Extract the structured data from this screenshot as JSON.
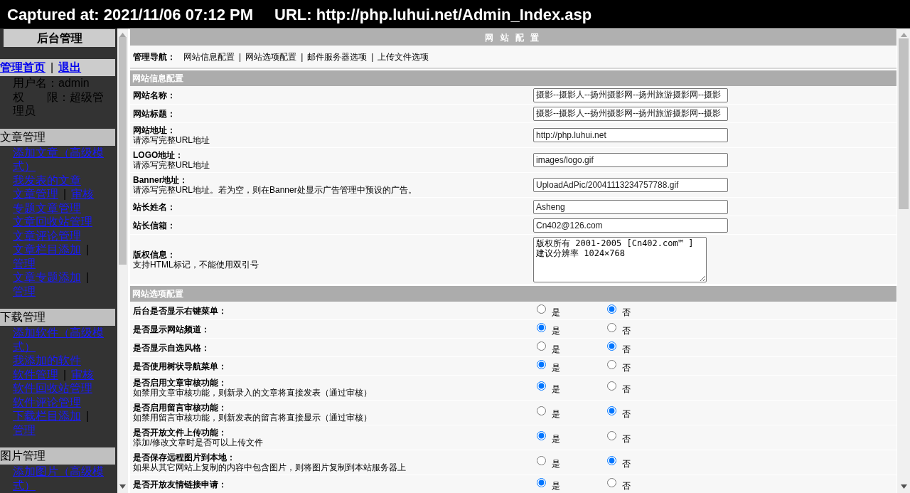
{
  "capture_bar": {
    "captured": "Captured at: 2021/11/06 07:12 PM",
    "url": "URL: http://php.luhui.net/Admin_Index.asp"
  },
  "sidebar": {
    "title": "后台管理",
    "nav": [
      {
        "kind": "link",
        "text": "管理首页"
      },
      {
        "kind": "sep",
        "text": "|"
      },
      {
        "kind": "link",
        "text": "退出"
      }
    ],
    "user_lines": [
      "用户名：admin",
      "权　　限：超级管理员"
    ],
    "sections": [
      {
        "title": "文章管理",
        "items": [
          [
            {
              "kind": "link",
              "text": "添加文章（高级模式）"
            }
          ],
          [
            {
              "kind": "link",
              "text": "我发表的文章"
            }
          ],
          [
            {
              "kind": "link",
              "text": "文章管理"
            },
            {
              "kind": "sep",
              "text": "|"
            },
            {
              "kind": "link",
              "text": "审核"
            }
          ],
          [
            {
              "kind": "link",
              "text": "专题文章管理"
            }
          ],
          [
            {
              "kind": "link",
              "text": "文章回收站管理"
            }
          ],
          [
            {
              "kind": "link",
              "text": "文章评论管理"
            }
          ],
          [
            {
              "kind": "link",
              "text": "文章栏目添加"
            },
            {
              "kind": "sep",
              "text": "|"
            },
            {
              "kind": "link",
              "text": "管理"
            }
          ],
          [
            {
              "kind": "link",
              "text": "文章专题添加"
            },
            {
              "kind": "sep",
              "text": "|"
            },
            {
              "kind": "link",
              "text": "管理"
            }
          ]
        ]
      },
      {
        "title": "下载管理",
        "items": [
          [
            {
              "kind": "link",
              "text": "添加软件（高级模式）"
            }
          ],
          [
            {
              "kind": "link",
              "text": "我添加的软件"
            }
          ],
          [
            {
              "kind": "link",
              "text": "软件管理"
            },
            {
              "kind": "sep",
              "text": "|"
            },
            {
              "kind": "link",
              "text": "审核"
            }
          ],
          [
            {
              "kind": "link",
              "text": "软件回收站管理"
            }
          ],
          [
            {
              "kind": "link",
              "text": "软件评论管理"
            }
          ],
          [
            {
              "kind": "link",
              "text": "下载栏目添加"
            },
            {
              "kind": "sep",
              "text": "|"
            },
            {
              "kind": "link",
              "text": "管理"
            }
          ]
        ]
      },
      {
        "title": "图片管理",
        "items": [
          [
            {
              "kind": "link",
              "text": "添加图片（高级模式）"
            }
          ]
        ]
      }
    ]
  },
  "main": {
    "title": "网 站 配 置",
    "nav_label": "管理导航：",
    "nav": [
      {
        "kind": "link",
        "text": "网站信息配置"
      },
      {
        "kind": "sep",
        "text": "|"
      },
      {
        "kind": "link",
        "text": "网站选项配置"
      },
      {
        "kind": "sep",
        "text": "|"
      },
      {
        "kind": "link",
        "text": "邮件服务器选项"
      },
      {
        "kind": "sep",
        "text": "|"
      },
      {
        "kind": "link",
        "text": "上传文件选项"
      }
    ],
    "sections": [
      {
        "title": "网站信息配置",
        "rows": [
          {
            "kind": "text",
            "label": "网站名称：",
            "value": "摄影--摄影人--扬州摄影网--扬州旅游摄影网--摄影"
          },
          {
            "kind": "text",
            "label": "网站标题：",
            "value": "摄影--摄影人--扬州摄影网--扬州旅游摄影网--摄影"
          },
          {
            "kind": "text",
            "label": "网站地址：",
            "hint": "请添写完整URL地址",
            "value": "http://php.luhui.net"
          },
          {
            "kind": "text",
            "label": "LOGO地址：",
            "hint": "请添写完整URL地址",
            "value": "images/logo.gif"
          },
          {
            "kind": "text",
            "label": "Banner地址：",
            "hint": "请添写完整URL地址。若为空，则在Banner处显示广告管理中预设的广告。",
            "value": "UploadAdPic/20041113234757788.gif"
          },
          {
            "kind": "text",
            "label": "站长姓名：",
            "value": "Asheng"
          },
          {
            "kind": "text",
            "label": "站长信箱：",
            "value": "Cn402@126.com"
          },
          {
            "kind": "textarea",
            "label": "版权信息：",
            "hint": "支持HTML标记，不能使用双引号",
            "value": "版权所有 2001-2005 [Cn402.com™ ]\n建议分辨率 1024×768"
          }
        ]
      },
      {
        "title": "网站选项配置",
        "rows": [
          {
            "kind": "radio",
            "label": "后台是否显示右键菜单：",
            "options": [
              {
                "text": "是",
                "selected": false
              },
              {
                "text": "否",
                "selected": true
              }
            ]
          },
          {
            "kind": "radio",
            "label": "是否显示网站频道：",
            "options": [
              {
                "text": "是",
                "selected": true
              },
              {
                "text": "否",
                "selected": false
              }
            ]
          },
          {
            "kind": "radio",
            "label": "是否显示自选风格：",
            "options": [
              {
                "text": "是",
                "selected": false
              },
              {
                "text": "否",
                "selected": true
              }
            ]
          },
          {
            "kind": "radio",
            "label": "是否使用树状导航菜单：",
            "options": [
              {
                "text": "是",
                "selected": true
              },
              {
                "text": "否",
                "selected": false
              }
            ]
          },
          {
            "kind": "radio",
            "label": "是否启用文章审核功能：",
            "hint": "如禁用文章审核功能，则新录入的文章将直接发表（通过审核）",
            "options": [
              {
                "text": "是",
                "selected": true
              },
              {
                "text": "否",
                "selected": false
              }
            ]
          },
          {
            "kind": "radio",
            "label": "是否启用留言审核功能：",
            "hint": "如禁用留言审核功能，则新发表的留言将直接显示（通过审核）",
            "options": [
              {
                "text": "是",
                "selected": false
              },
              {
                "text": "否",
                "selected": true
              }
            ]
          },
          {
            "kind": "radio",
            "label": "是否开放文件上传功能：",
            "hint": "添加/修改文章时是否可以上传文件",
            "options": [
              {
                "text": "是",
                "selected": true
              },
              {
                "text": "否",
                "selected": false
              }
            ]
          },
          {
            "kind": "radio",
            "label": "是否保存远程图片到本地：",
            "hint": "如果从其它网站上复制的内容中包含图片，则将图片复制到本站服务器上",
            "options": [
              {
                "text": "是",
                "selected": false
              },
              {
                "text": "否",
                "selected": true
              }
            ]
          },
          {
            "kind": "radio",
            "label": "是否开放友情链接申请：",
            "options": [
              {
                "text": "是",
                "selected": true
              },
              {
                "text": "否",
                "selected": false
              }
            ]
          }
        ]
      }
    ]
  }
}
